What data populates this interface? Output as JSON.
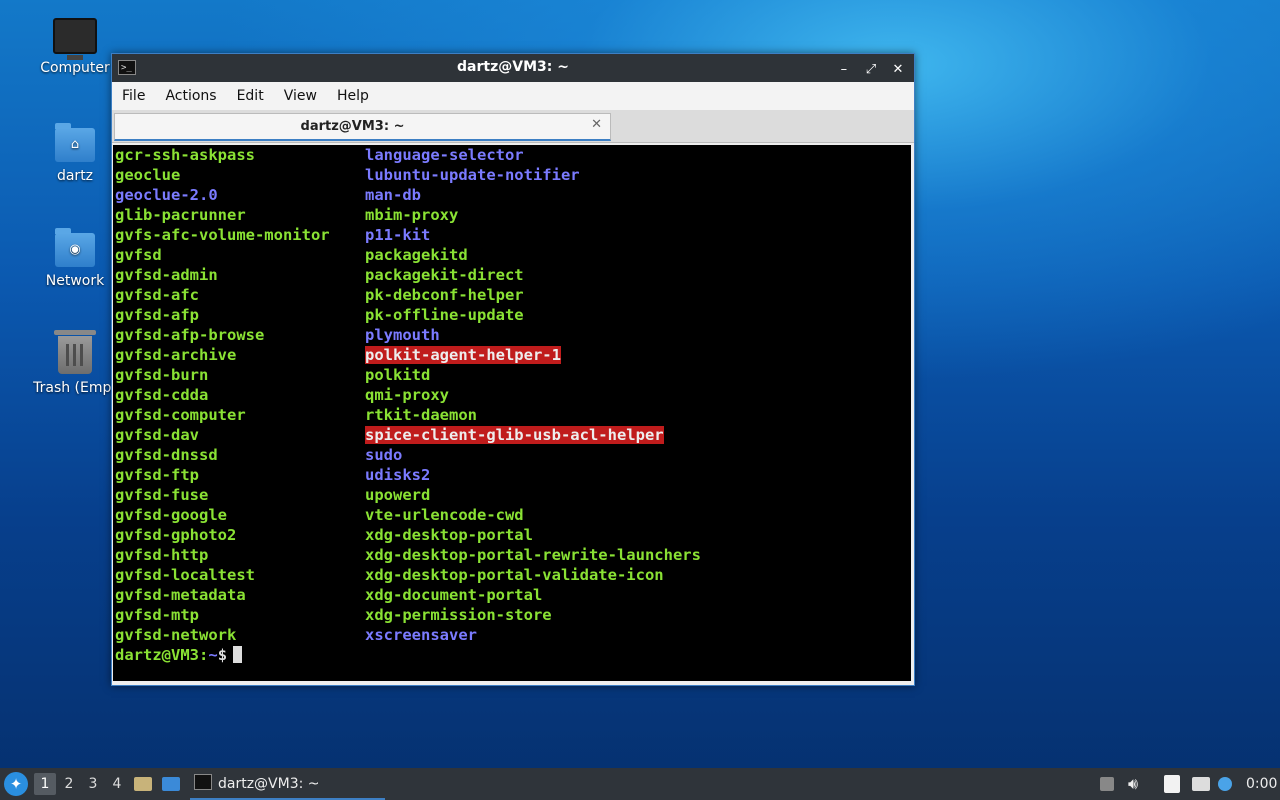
{
  "desktop": {
    "icons": [
      {
        "label": "Computer"
      },
      {
        "label": "dartz"
      },
      {
        "label": "Network"
      },
      {
        "label": "Trash (Empt"
      }
    ]
  },
  "window": {
    "title": "dartz@VM3: ~",
    "buttons": {
      "minimize": "–",
      "maximize": "⤢",
      "close": "✕"
    },
    "menu": [
      "File",
      "Actions",
      "Edit",
      "View",
      "Help"
    ],
    "tab": {
      "label": "dartz@VM3: ~",
      "close": "✕"
    }
  },
  "terminal": {
    "col1": [
      "gcr-ssh-askpass",
      "geoclue",
      "geoclue-2.0",
      "glib-pacrunner",
      "gvfs-afc-volume-monitor",
      "gvfsd",
      "gvfsd-admin",
      "gvfsd-afc",
      "gvfsd-afp",
      "gvfsd-afp-browse",
      "gvfsd-archive",
      "gvfsd-burn",
      "gvfsd-cdda",
      "gvfsd-computer",
      "gvfsd-dav",
      "gvfsd-dnssd",
      "gvfsd-ftp",
      "gvfsd-fuse",
      "gvfsd-google",
      "gvfsd-gphoto2",
      "gvfsd-http",
      "gvfsd-localtest",
      "gvfsd-metadata",
      "gvfsd-mtp",
      "gvfsd-network"
    ],
    "col2": [
      "language-selector",
      "lubuntu-update-notifier",
      "man-db",
      "mbim-proxy",
      "p11-kit",
      "packagekitd",
      "packagekit-direct",
      "pk-debconf-helper",
      "pk-offline-update",
      "plymouth",
      "polkit-agent-helper-1",
      "polkitd",
      "qmi-proxy",
      "rtkit-daemon",
      "spice-client-glib-usb-acl-helper",
      "sudo",
      "udisks2",
      "upowerd",
      "vte-urlencode-cwd",
      "xdg-desktop-portal",
      "xdg-desktop-portal-rewrite-launchers",
      "xdg-desktop-portal-validate-icon",
      "xdg-document-portal",
      "xdg-permission-store",
      "xscreensaver"
    ],
    "col1_colors": [
      "g",
      "g",
      "b",
      "g",
      "g",
      "g",
      "g",
      "g",
      "g",
      "g",
      "g",
      "g",
      "g",
      "g",
      "g",
      "g",
      "g",
      "g",
      "g",
      "g",
      "g",
      "g",
      "g",
      "g",
      "g"
    ],
    "col2_colors": [
      "b",
      "b",
      "b",
      "g",
      "b",
      "g",
      "g",
      "g",
      "g",
      "b",
      "r",
      "g",
      "g",
      "g",
      "r",
      "b",
      "b",
      "g",
      "g",
      "g",
      "g",
      "g",
      "g",
      "g",
      "b"
    ],
    "prompt": {
      "user": "dartz@VM3",
      "sep": ":",
      "path": "~",
      "symbol": "$"
    }
  },
  "taskbar": {
    "workspaces": [
      "1",
      "2",
      "3",
      "4"
    ],
    "active_workspace": "1",
    "task_label": "dartz@VM3: ~",
    "clock": "0:00"
  }
}
